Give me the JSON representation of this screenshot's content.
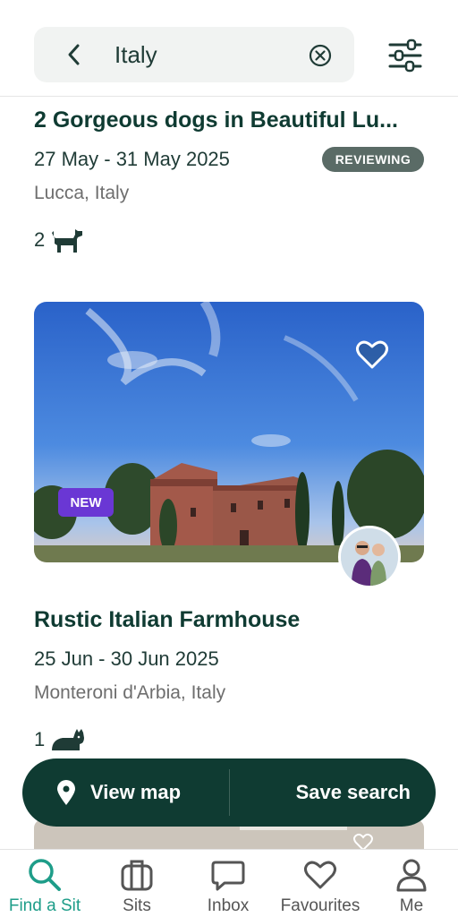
{
  "search": {
    "query": "Italy"
  },
  "listings": [
    {
      "title": "2 Gorgeous dogs in Beautiful Lu...",
      "dates": "27 May - 31 May 2025",
      "location": "Lucca, Italy",
      "status": "REVIEWING",
      "pet_count": "2",
      "pet_icon": "dog-icon"
    },
    {
      "title": "Rustic Italian Farmhouse",
      "dates": "25 Jun - 30 Jun 2025",
      "location": "Monteroni d'Arbia, Italy",
      "badge": "NEW",
      "pet_count": "1",
      "pet_icon": "cat-icon"
    }
  ],
  "actions": {
    "map_label": "View map",
    "save_label": "Save search"
  },
  "nav": {
    "items": [
      {
        "label": "Find a Sit",
        "icon": "search-icon",
        "active": true
      },
      {
        "label": "Sits",
        "icon": "briefcase-icon"
      },
      {
        "label": "Inbox",
        "icon": "chat-icon"
      },
      {
        "label": "Favourites",
        "icon": "heart-icon"
      },
      {
        "label": "Me",
        "icon": "user-icon"
      }
    ]
  },
  "colors": {
    "brand_dark": "#0f3b32",
    "accent_teal": "#1e9d89",
    "new_badge": "#6a37d4",
    "status_badge": "#5a6b66"
  }
}
